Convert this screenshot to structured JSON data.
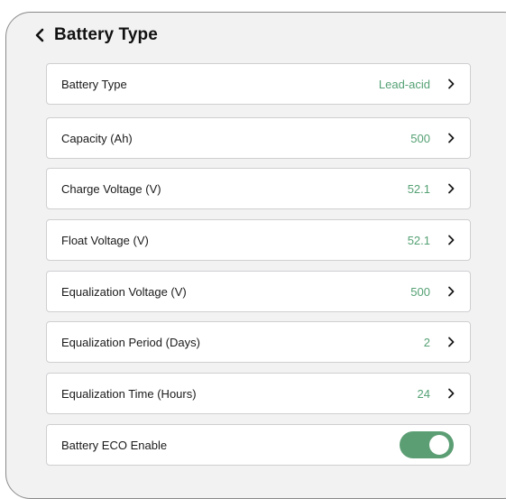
{
  "header": {
    "title": "Battery Type",
    "back_icon": "chevron-left-icon"
  },
  "colors": {
    "accent": "#5c9e74",
    "value_text": "#55a174",
    "background": "#f2f2f3",
    "card": "#ffffff"
  },
  "settings": [
    {
      "label": "Battery Type",
      "value": "Lead-acid",
      "icon": "chevron-right-icon"
    },
    {
      "label": "Capacity (Ah)",
      "value": "500",
      "icon": "chevron-right-icon"
    },
    {
      "label": "Charge Voltage (V)",
      "value": "52.1",
      "icon": "chevron-right-icon"
    },
    {
      "label": "Float Voltage (V)",
      "value": "52.1",
      "icon": "chevron-right-icon"
    },
    {
      "label": "Equalization Voltage (V)",
      "value": "500",
      "icon": "chevron-right-icon"
    },
    {
      "label": "Equalization Period (Days)",
      "value": "2",
      "icon": "chevron-right-icon"
    },
    {
      "label": "Equalization Time (Hours)",
      "value": "24",
      "icon": "chevron-right-icon"
    }
  ],
  "eco": {
    "label": "Battery ECO Enable",
    "enabled": true
  }
}
